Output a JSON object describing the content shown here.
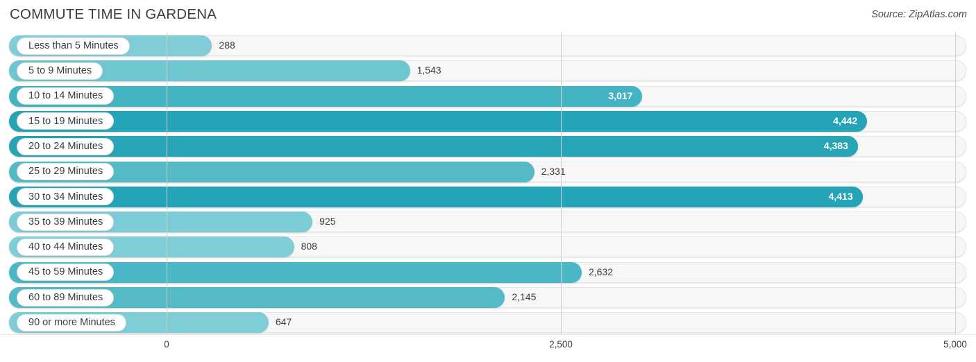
{
  "header": {
    "title": "COMMUTE TIME IN GARDENA",
    "source": "Source: ZipAtlas.com"
  },
  "colors": {
    "bar_light": "#7ecdd7",
    "bar_mid": "#4cb8c4",
    "bar_dark": "#25a3b6",
    "track_bg": "#f7f7f7",
    "track_border": "#e4e4e4",
    "gridline": "#d0d0d0",
    "text": "#3a3c44",
    "value_inside": "#ffffff"
  },
  "chart_data": {
    "type": "bar",
    "orientation": "horizontal",
    "title": "COMMUTE TIME IN GARDENA",
    "xlabel": "",
    "ylabel": "",
    "xlim": [
      0,
      5000
    ],
    "grid": true,
    "legend": null,
    "xticks": [
      {
        "label": "0",
        "value": 0
      },
      {
        "label": "2,500",
        "value": 2500
      },
      {
        "label": "5,000",
        "value": 5000
      }
    ],
    "categories": [
      "Less than 5 Minutes",
      "5 to 9 Minutes",
      "10 to 14 Minutes",
      "15 to 19 Minutes",
      "20 to 24 Minutes",
      "25 to 29 Minutes",
      "30 to 34 Minutes",
      "35 to 39 Minutes",
      "40 to 44 Minutes",
      "45 to 59 Minutes",
      "60 to 89 Minutes",
      "90 or more Minutes"
    ],
    "values": [
      288,
      1543,
      3017,
      4442,
      4383,
      2331,
      4413,
      925,
      808,
      2632,
      2145,
      647
    ],
    "value_labels": [
      "288",
      "1,543",
      "3,017",
      "4,442",
      "4,383",
      "2,331",
      "4,413",
      "925",
      "808",
      "2,632",
      "2,145",
      "647"
    ]
  },
  "rows": [
    {
      "label": "Less than 5 Minutes",
      "value": 288,
      "value_label": "288",
      "color": "#81cdd7",
      "inside": false
    },
    {
      "label": "5 to 9 Minutes",
      "value": 1543,
      "value_label": "1,543",
      "color": "#6ec6d1",
      "inside": false
    },
    {
      "label": "10 to 14 Minutes",
      "value": 3017,
      "value_label": "3,017",
      "color": "#45b4c2",
      "inside": true
    },
    {
      "label": "15 to 19 Minutes",
      "value": 4442,
      "value_label": "4,442",
      "color": "#26a4b7",
      "inside": true
    },
    {
      "label": "20 to 24 Minutes",
      "value": 4383,
      "value_label": "4,383",
      "color": "#27a5b7",
      "inside": true
    },
    {
      "label": "25 to 29 Minutes",
      "value": 2331,
      "value_label": "2,331",
      "color": "#54bac6",
      "inside": false
    },
    {
      "label": "30 to 34 Minutes",
      "value": 4413,
      "value_label": "4,413",
      "color": "#26a4b7",
      "inside": true
    },
    {
      "label": "35 to 39 Minutes",
      "value": 925,
      "value_label": "925",
      "color": "#7bccd6",
      "inside": false
    },
    {
      "label": "40 to 44 Minutes",
      "value": 808,
      "value_label": "808",
      "color": "#7ecdd7",
      "inside": false
    },
    {
      "label": "45 to 59 Minutes",
      "value": 2632,
      "value_label": "2,632",
      "color": "#4ab7c4",
      "inside": false
    },
    {
      "label": "60 to 89 Minutes",
      "value": 2145,
      "value_label": "2,145",
      "color": "#54bac6",
      "inside": false
    },
    {
      "label": "90 or more Minutes",
      "value": 647,
      "value_label": "647",
      "color": "#7ecdd7",
      "inside": false
    }
  ]
}
